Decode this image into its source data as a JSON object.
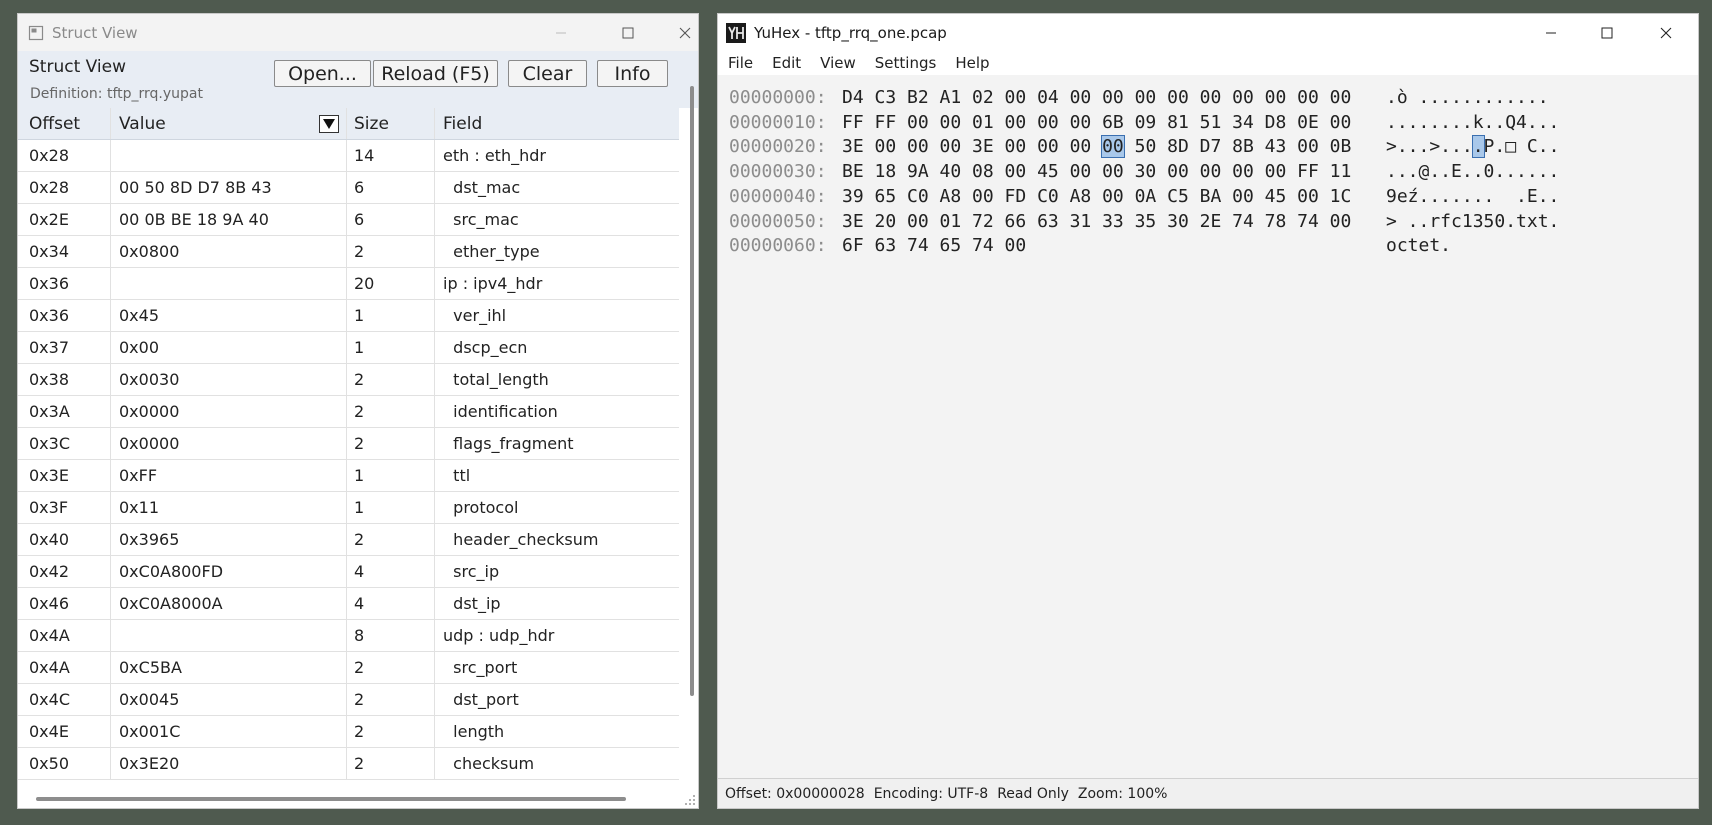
{
  "struct_window": {
    "title": "Struct View",
    "panel_title": "Struct View",
    "definition": "Definition: tftp_rrq.yupat",
    "buttons": {
      "open": "Open...",
      "reload": "Reload (F5)",
      "clear": "Clear",
      "info": "Info"
    },
    "columns": {
      "offset": "Offset",
      "value": "Value",
      "size": "Size",
      "field": "Field"
    },
    "rows": [
      {
        "offset": "0x28",
        "value": "",
        "size": "14",
        "field": "eth : eth_hdr"
      },
      {
        "offset": "0x28",
        "value": "00 50 8D D7 8B 43",
        "size": "6",
        "field": "  dst_mac"
      },
      {
        "offset": "0x2E",
        "value": "00 0B BE 18 9A 40",
        "size": "6",
        "field": "  src_mac"
      },
      {
        "offset": "0x34",
        "value": "0x0800",
        "size": "2",
        "field": "  ether_type"
      },
      {
        "offset": "0x36",
        "value": "",
        "size": "20",
        "field": "ip : ipv4_hdr"
      },
      {
        "offset": "0x36",
        "value": "0x45",
        "size": "1",
        "field": "  ver_ihl"
      },
      {
        "offset": "0x37",
        "value": "0x00",
        "size": "1",
        "field": "  dscp_ecn"
      },
      {
        "offset": "0x38",
        "value": "0x0030",
        "size": "2",
        "field": "  total_length"
      },
      {
        "offset": "0x3A",
        "value": "0x0000",
        "size": "2",
        "field": "  identification"
      },
      {
        "offset": "0x3C",
        "value": "0x0000",
        "size": "2",
        "field": "  flags_fragment"
      },
      {
        "offset": "0x3E",
        "value": "0xFF",
        "size": "1",
        "field": "  ttl"
      },
      {
        "offset": "0x3F",
        "value": "0x11",
        "size": "1",
        "field": "  protocol"
      },
      {
        "offset": "0x40",
        "value": "0x3965",
        "size": "2",
        "field": "  header_checksum"
      },
      {
        "offset": "0x42",
        "value": "0xC0A800FD",
        "size": "4",
        "field": "  src_ip"
      },
      {
        "offset": "0x46",
        "value": "0xC0A8000A",
        "size": "4",
        "field": "  dst_ip"
      },
      {
        "offset": "0x4A",
        "value": "",
        "size": "8",
        "field": "udp : udp_hdr"
      },
      {
        "offset": "0x4A",
        "value": "0xC5BA",
        "size": "2",
        "field": "  src_port"
      },
      {
        "offset": "0x4C",
        "value": "0x0045",
        "size": "2",
        "field": "  dst_port"
      },
      {
        "offset": "0x4E",
        "value": "0x001C",
        "size": "2",
        "field": "  length"
      },
      {
        "offset": "0x50",
        "value": "0x3E20",
        "size": "2",
        "field": "  checksum"
      }
    ]
  },
  "hex_window": {
    "title": "YuHex - tftp_rrq_one.pcap",
    "menu": [
      "File",
      "Edit",
      "View",
      "Settings",
      "Help"
    ],
    "lines": [
      {
        "offset": "00000000:",
        "pre": "D4 C3 B2 A1 02 00 04 00 00 00 00 00 00 00 00 00",
        "sel": "",
        "post": "",
        "ascii_pre": ".ò ............",
        "ascii_sel": "",
        "ascii_post": ""
      },
      {
        "offset": "00000010:",
        "pre": "FF FF 00 00 01 00 00 00 6B 09 81 51 34 D8 0E 00",
        "sel": "",
        "post": "",
        "ascii_pre": "........k..Q4...",
        "ascii_sel": "",
        "ascii_post": ""
      },
      {
        "offset": "00000020:",
        "pre": "3E 00 00 00 3E 00 00 00 ",
        "sel": "00",
        "post": " 50 8D D7 8B 43 00 0B",
        "ascii_pre": ">...>...",
        "ascii_sel": ".",
        "ascii_post": "P.□ C.."
      },
      {
        "offset": "00000030:",
        "pre": "BE 18 9A 40 08 00 45 00 00 30 00 00 00 00 FF 11",
        "sel": "",
        "post": "",
        "ascii_pre": "...@..E..0......",
        "ascii_sel": "",
        "ascii_post": ""
      },
      {
        "offset": "00000040:",
        "pre": "39 65 C0 A8 00 FD C0 A8 00 0A C5 BA 00 45 00 1C",
        "sel": "",
        "post": "",
        "ascii_pre": "9eź.......  .E..",
        "ascii_sel": "",
        "ascii_post": ""
      },
      {
        "offset": "00000050:",
        "pre": "3E 20 00 01 72 66 63 31 33 35 30 2E 74 78 74 00",
        "sel": "",
        "post": "",
        "ascii_pre": "> ..rfc1350.txt.",
        "ascii_sel": "",
        "ascii_post": ""
      },
      {
        "offset": "00000060:",
        "pre": "6F 63 74 65 74 00",
        "sel": "",
        "post": "",
        "ascii_pre": "octet.",
        "ascii_sel": "",
        "ascii_post": ""
      }
    ],
    "status": {
      "offset": "Offset: 0x00000028",
      "encoding": "Encoding: UTF-8",
      "mode": "Read Only",
      "zoom": "Zoom: 100%"
    }
  },
  "icons": {
    "struct": "window-icon",
    "hex": "yuhex-app-icon"
  },
  "colors": {
    "accent_header": "#e8edf4",
    "selection": "#a9c8ea",
    "desktop": "#4f5a4f"
  }
}
